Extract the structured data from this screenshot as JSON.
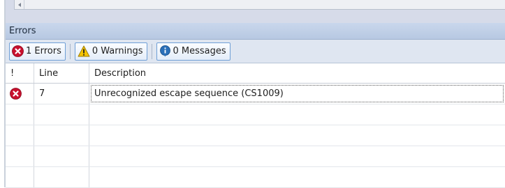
{
  "panel": {
    "title": "Errors"
  },
  "toolbar": {
    "errors_label": "1 Errors",
    "warnings_label": "0 Warnings",
    "messages_label": "0 Messages"
  },
  "grid": {
    "columns": [
      "!",
      "Line",
      "Description"
    ],
    "rows": [
      {
        "icon": "error-icon",
        "line": "7",
        "description": "Unrecognized escape sequence (CS1009)"
      }
    ]
  },
  "icons": {
    "error": "error-icon",
    "warning": "warning-icon",
    "info": "info-icon"
  },
  "colors": {
    "error": "#c8102e",
    "warning": "#f5c400",
    "info": "#2a6fb8",
    "title_bar": "#c3d2ea"
  }
}
